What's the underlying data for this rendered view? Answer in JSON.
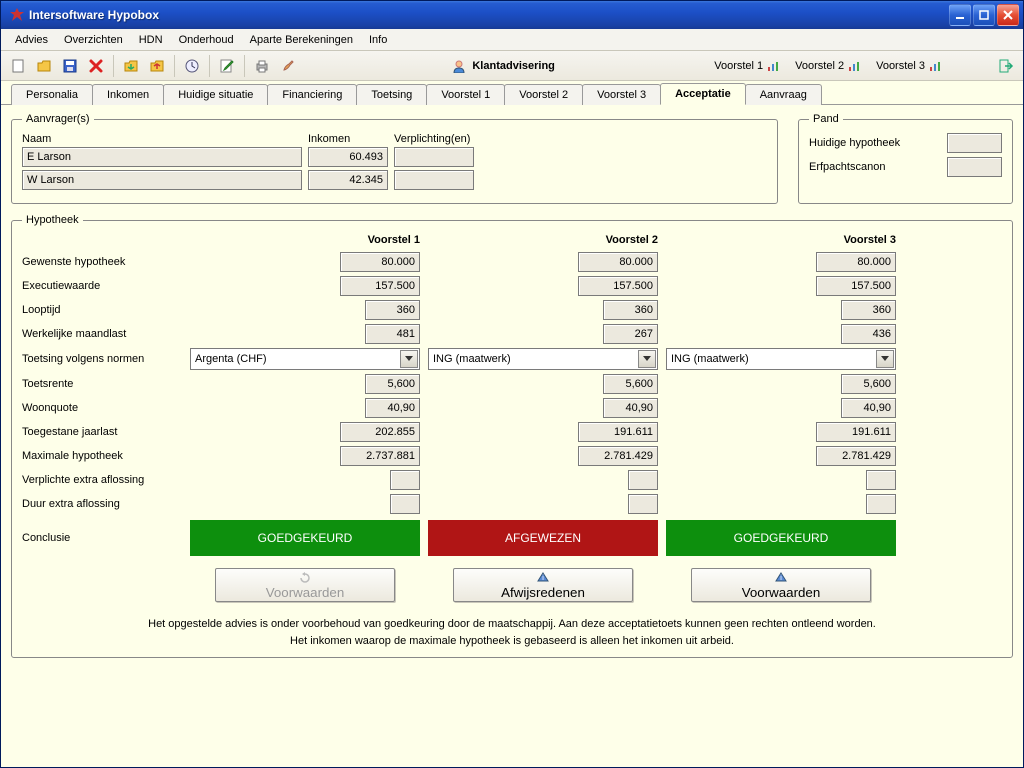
{
  "window": {
    "title": "Intersoftware Hypobox"
  },
  "menu": {
    "items": [
      "Advies",
      "Overzichten",
      "HDN",
      "Onderhoud",
      "Aparte Berekeningen",
      "Info"
    ]
  },
  "toolbar": {
    "center_label": "Klantadvisering",
    "links": [
      "Voorstel 1",
      "Voorstel 2",
      "Voorstel 3"
    ]
  },
  "tabs": {
    "items": [
      "Personalia",
      "Inkomen",
      "Huidige situatie",
      "Financiering",
      "Toetsing",
      "Voorstel 1",
      "Voorstel 2",
      "Voorstel 3",
      "Acceptatie",
      "Aanvraag"
    ],
    "active": "Acceptatie"
  },
  "aanvragers": {
    "legend": "Aanvrager(s)",
    "cols": {
      "naam": "Naam",
      "inkomen": "Inkomen",
      "verplichting": "Verplichting(en)"
    },
    "rows": [
      {
        "naam": "E Larson",
        "inkomen": "60.493",
        "verplichting": ""
      },
      {
        "naam": "W Larson",
        "inkomen": "42.345",
        "verplichting": ""
      }
    ]
  },
  "pand": {
    "legend": "Pand",
    "huidige": {
      "label": "Huidige hypotheek",
      "value": ""
    },
    "erfpacht": {
      "label": "Erfpachtscanon",
      "value": ""
    }
  },
  "hypotheek": {
    "legend": "Hypotheek",
    "col_headers": [
      "Voorstel 1",
      "Voorstel 2",
      "Voorstel 3"
    ],
    "rows": {
      "gewenste": {
        "label": "Gewenste hypotheek",
        "v": [
          "80.000",
          "80.000",
          "80.000"
        ]
      },
      "executie": {
        "label": "Executiewaarde",
        "v": [
          "157.500",
          "157.500",
          "157.500"
        ]
      },
      "looptijd": {
        "label": "Looptijd",
        "v": [
          "360",
          "360",
          "360"
        ]
      },
      "maandlast": {
        "label": "Werkelijke maandlast",
        "v": [
          "481",
          "267",
          "436"
        ]
      },
      "toetsing_normen": {
        "label": "Toetsing volgens normen",
        "v": [
          "Argenta (CHF)",
          "ING (maatwerk)",
          "ING (maatwerk)"
        ]
      },
      "toetsrente": {
        "label": "Toetsrente",
        "v": [
          "5,600",
          "5,600",
          "5,600"
        ]
      },
      "woonquote": {
        "label": "Woonquote",
        "v": [
          "40,90",
          "40,90",
          "40,90"
        ]
      },
      "toegestane": {
        "label": "Toegestane jaarlast",
        "v": [
          "202.855",
          "191.611",
          "191.611"
        ]
      },
      "maximale": {
        "label": "Maximale hypotheek",
        "v": [
          "2.737.881",
          "2.781.429",
          "2.781.429"
        ]
      },
      "verplichte": {
        "label": "Verplichte extra aflossing",
        "v": [
          "",
          "",
          ""
        ]
      },
      "duur": {
        "label": "Duur extra aflossing",
        "v": [
          "",
          "",
          ""
        ]
      },
      "conclusie": {
        "label": "Conclusie",
        "v": [
          "GOEDGEKEURD",
          "AFGEWEZEN",
          "GOEDGEKEURD"
        ],
        "status": [
          "green",
          "red",
          "green"
        ]
      }
    },
    "detail_buttons": [
      {
        "label": "Voorwaarden",
        "disabled": true
      },
      {
        "label": "Afwijsredenen",
        "disabled": false
      },
      {
        "label": "Voorwaarden",
        "disabled": false
      }
    ]
  },
  "footnote": {
    "line1": "Het opgestelde advies is onder voorbehoud van goedkeuring door de maatschappij. Aan deze acceptatietoets kunnen geen rechten ontleend worden.",
    "line2": "Het inkomen waarop de maximale hypotheek is gebaseerd is alleen het inkomen uit arbeid."
  }
}
